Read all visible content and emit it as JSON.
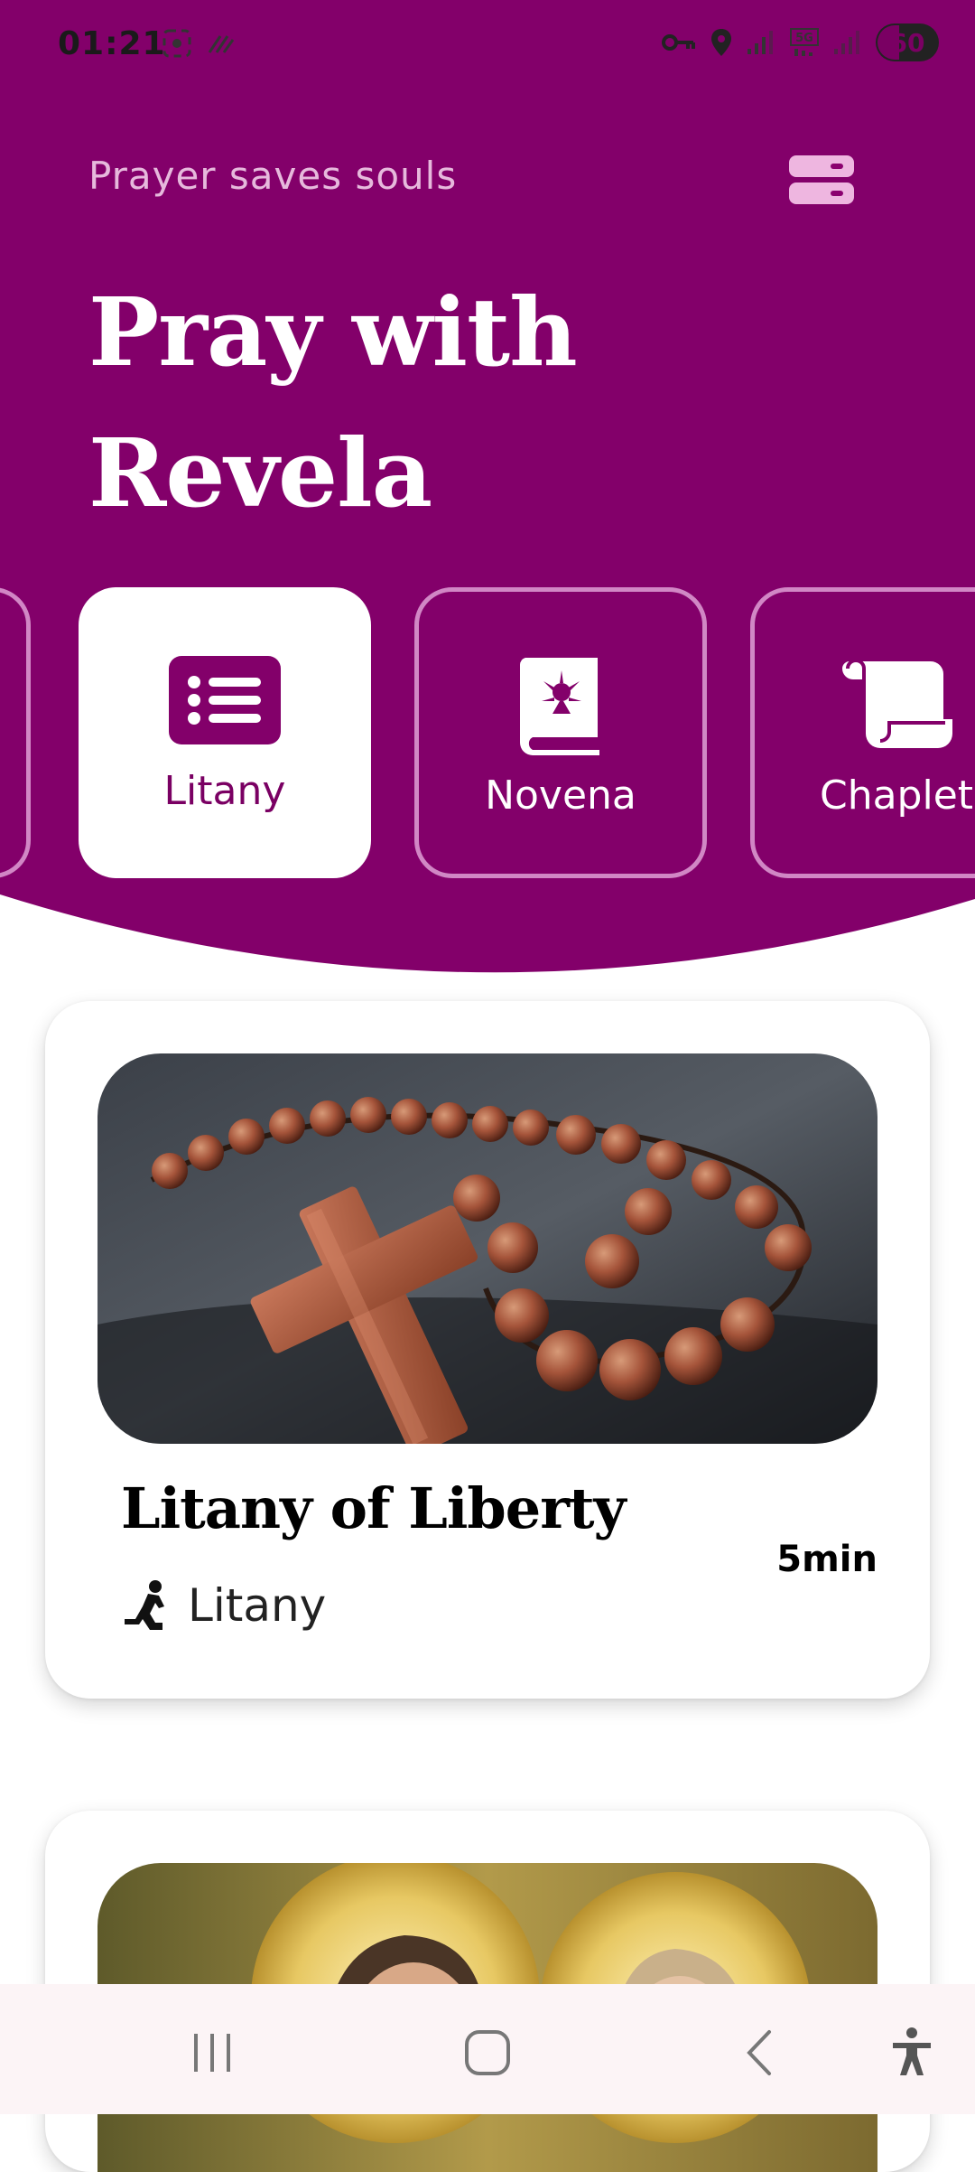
{
  "status_bar": {
    "time": "01:21",
    "battery": "60",
    "left_icons": [
      "screenshot-icon",
      "data-saver-icon"
    ],
    "right_icons": [
      "vpn-key-icon",
      "location-icon",
      "signal-icon",
      "5g-icon",
      "signal-icon"
    ]
  },
  "header": {
    "subtitle": "Prayer saves souls",
    "title": "Pray with Revela",
    "menu_icon": "menu-icon",
    "colors": {
      "primary": "#83006A",
      "accent_light": "#EEB6E0",
      "outline": "#D187C5"
    }
  },
  "categories": [
    {
      "label": "Litany",
      "icon": "list-icon",
      "selected": true
    },
    {
      "label": "Novena",
      "icon": "book-icon",
      "selected": false
    },
    {
      "label": "Chaplet",
      "icon": "scroll-icon",
      "selected": false
    }
  ],
  "cards": [
    {
      "title": "Litany of Liberty",
      "duration": "5min",
      "type": "Litany",
      "type_icon": "kneeling-person-icon",
      "image": "rosary-with-wooden-cross-image"
    },
    {
      "image": "saints-painting-image"
    }
  ],
  "nav": {
    "items": [
      "recent-apps-icon",
      "home-icon",
      "back-icon",
      "accessibility-icon"
    ]
  }
}
